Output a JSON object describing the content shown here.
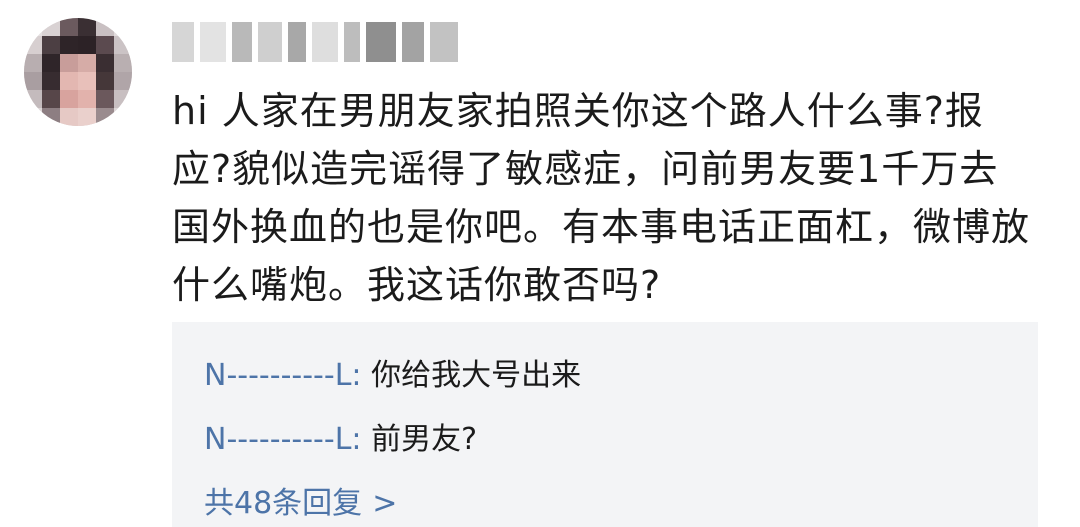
{
  "comment": {
    "avatar_icon": "user-avatar-icon",
    "username": "",
    "text": "hi  人家在男朋友家拍照关你这个路人什么事?报应?貌似造完谣得了敏感症，问前男友要1千万去国外换血的也是你吧。有本事电话正面杠，微博放什么嘴炮。我这话你敢否吗?"
  },
  "replies": {
    "items": [
      {
        "author": "N----------L",
        "separator": ": ",
        "text": "你给我大号出来"
      },
      {
        "author": "N----------L",
        "separator": ": ",
        "text": "前男友?"
      }
    ],
    "more_label": "共48条回复",
    "more_icon": "chevron-right-icon"
  },
  "colors": {
    "link": "#4d74a8",
    "reply_bg": "#f3f4f6",
    "text": "#1b1b1b"
  }
}
